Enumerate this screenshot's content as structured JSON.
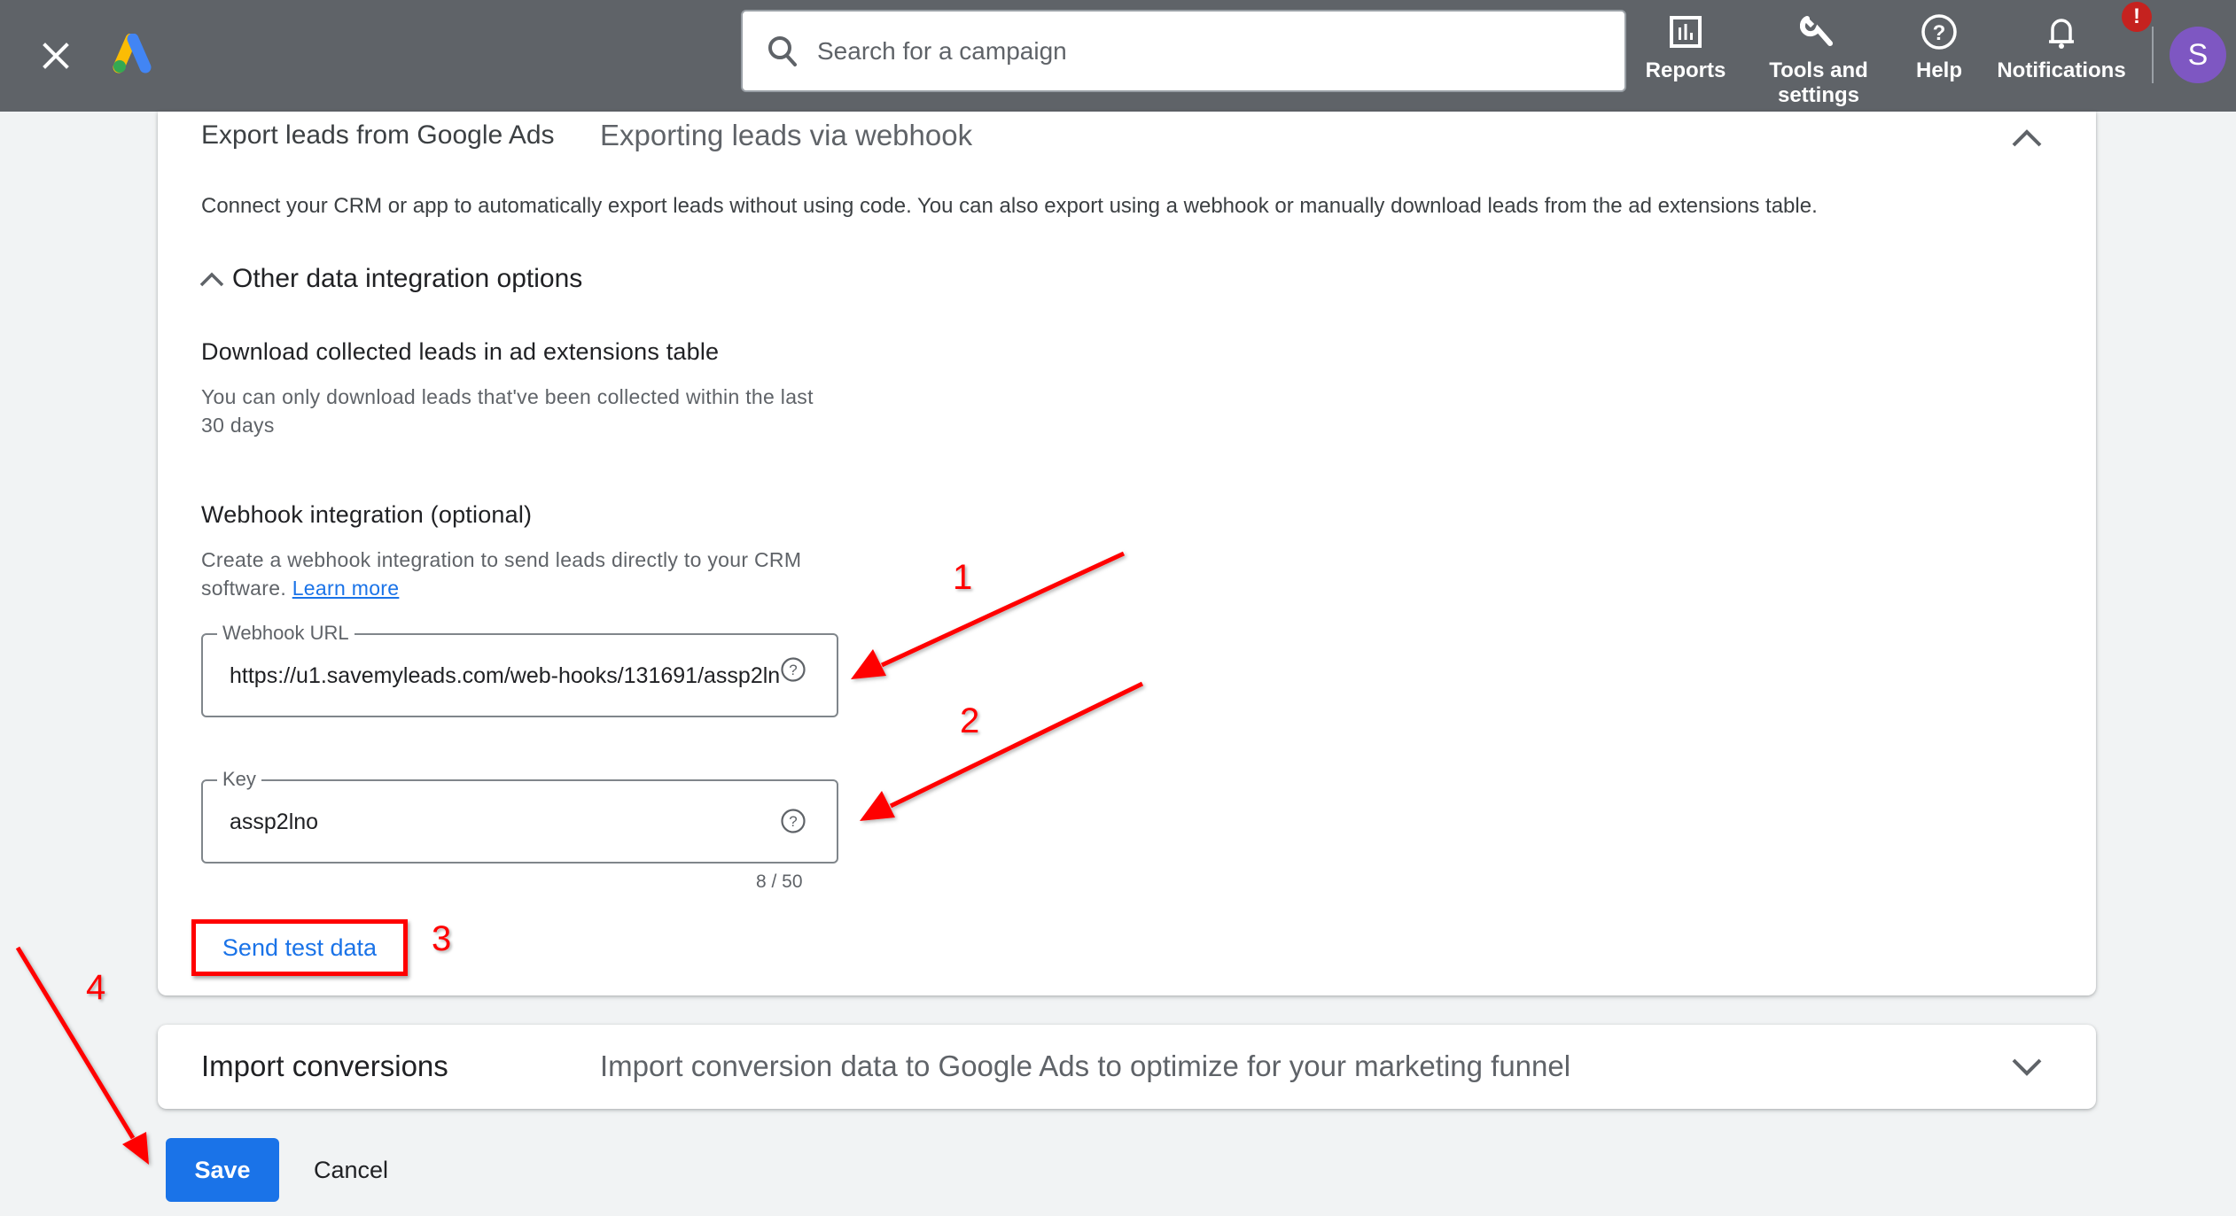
{
  "topbar": {
    "search_placeholder": "Search for a campaign",
    "nav": [
      {
        "label": "Reports",
        "icon": "reports-icon"
      },
      {
        "label": "Tools and settings",
        "icon": "wrench-icon"
      },
      {
        "label": "Help",
        "icon": "help-icon"
      },
      {
        "label": "Notifications",
        "icon": "bell-icon",
        "badge": "!"
      }
    ],
    "avatar_initial": "S"
  },
  "colors": {
    "topbar": "#5f6368",
    "accent": "#1a73e8",
    "avatar": "#7e57c2",
    "badge": "#c5221f",
    "annotation": "#ff0000"
  },
  "export_card": {
    "title": "Export leads from Google Ads",
    "subtitle": "Exporting leads via webhook",
    "description": "Connect your CRM or app to automatically export leads without using code. You can also export using a webhook or manually download leads from the ad extensions table.",
    "expander_label": "Other data integration options",
    "download_section": {
      "title": "Download collected leads in ad extensions table",
      "text": "You can only download leads that've been collected within the last 30 days"
    },
    "webhook_section": {
      "title": "Webhook integration (optional)",
      "text": "Create a webhook integration to send leads directly to your CRM software.",
      "learn_more": "Learn more",
      "url_field": {
        "label": "Webhook URL",
        "value": "https://u1.savemyleads.com/web-hooks/131691/assp2lno"
      },
      "key_field": {
        "label": "Key",
        "value": "assp2lno",
        "counter": "8 / 50"
      },
      "send_test_label": "Send test data"
    }
  },
  "import_card": {
    "title": "Import conversions",
    "subtitle": "Import conversion data to Google Ads to optimize for your marketing funnel"
  },
  "footer": {
    "save_label": "Save",
    "cancel_label": "Cancel"
  },
  "annotations": [
    "1",
    "2",
    "3",
    "4"
  ]
}
